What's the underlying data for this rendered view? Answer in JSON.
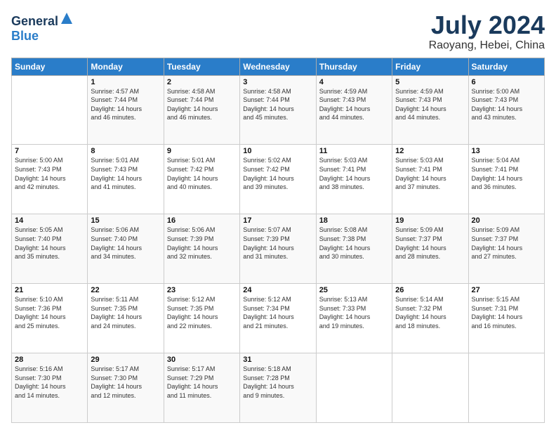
{
  "logo": {
    "general": "General",
    "blue": "Blue"
  },
  "header": {
    "month": "July 2024",
    "location": "Raoyang, Hebei, China"
  },
  "days_of_week": [
    "Sunday",
    "Monday",
    "Tuesday",
    "Wednesday",
    "Thursday",
    "Friday",
    "Saturday"
  ],
  "weeks": [
    [
      {
        "day": "",
        "content": ""
      },
      {
        "day": "1",
        "content": "Sunrise: 4:57 AM\nSunset: 7:44 PM\nDaylight: 14 hours\nand 46 minutes."
      },
      {
        "day": "2",
        "content": "Sunrise: 4:58 AM\nSunset: 7:44 PM\nDaylight: 14 hours\nand 46 minutes."
      },
      {
        "day": "3",
        "content": "Sunrise: 4:58 AM\nSunset: 7:44 PM\nDaylight: 14 hours\nand 45 minutes."
      },
      {
        "day": "4",
        "content": "Sunrise: 4:59 AM\nSunset: 7:43 PM\nDaylight: 14 hours\nand 44 minutes."
      },
      {
        "day": "5",
        "content": "Sunrise: 4:59 AM\nSunset: 7:43 PM\nDaylight: 14 hours\nand 44 minutes."
      },
      {
        "day": "6",
        "content": "Sunrise: 5:00 AM\nSunset: 7:43 PM\nDaylight: 14 hours\nand 43 minutes."
      }
    ],
    [
      {
        "day": "7",
        "content": "Sunrise: 5:00 AM\nSunset: 7:43 PM\nDaylight: 14 hours\nand 42 minutes."
      },
      {
        "day": "8",
        "content": "Sunrise: 5:01 AM\nSunset: 7:43 PM\nDaylight: 14 hours\nand 41 minutes."
      },
      {
        "day": "9",
        "content": "Sunrise: 5:01 AM\nSunset: 7:42 PM\nDaylight: 14 hours\nand 40 minutes."
      },
      {
        "day": "10",
        "content": "Sunrise: 5:02 AM\nSunset: 7:42 PM\nDaylight: 14 hours\nand 39 minutes."
      },
      {
        "day": "11",
        "content": "Sunrise: 5:03 AM\nSunset: 7:41 PM\nDaylight: 14 hours\nand 38 minutes."
      },
      {
        "day": "12",
        "content": "Sunrise: 5:03 AM\nSunset: 7:41 PM\nDaylight: 14 hours\nand 37 minutes."
      },
      {
        "day": "13",
        "content": "Sunrise: 5:04 AM\nSunset: 7:41 PM\nDaylight: 14 hours\nand 36 minutes."
      }
    ],
    [
      {
        "day": "14",
        "content": "Sunrise: 5:05 AM\nSunset: 7:40 PM\nDaylight: 14 hours\nand 35 minutes."
      },
      {
        "day": "15",
        "content": "Sunrise: 5:06 AM\nSunset: 7:40 PM\nDaylight: 14 hours\nand 34 minutes."
      },
      {
        "day": "16",
        "content": "Sunrise: 5:06 AM\nSunset: 7:39 PM\nDaylight: 14 hours\nand 32 minutes."
      },
      {
        "day": "17",
        "content": "Sunrise: 5:07 AM\nSunset: 7:39 PM\nDaylight: 14 hours\nand 31 minutes."
      },
      {
        "day": "18",
        "content": "Sunrise: 5:08 AM\nSunset: 7:38 PM\nDaylight: 14 hours\nand 30 minutes."
      },
      {
        "day": "19",
        "content": "Sunrise: 5:09 AM\nSunset: 7:37 PM\nDaylight: 14 hours\nand 28 minutes."
      },
      {
        "day": "20",
        "content": "Sunrise: 5:09 AM\nSunset: 7:37 PM\nDaylight: 14 hours\nand 27 minutes."
      }
    ],
    [
      {
        "day": "21",
        "content": "Sunrise: 5:10 AM\nSunset: 7:36 PM\nDaylight: 14 hours\nand 25 minutes."
      },
      {
        "day": "22",
        "content": "Sunrise: 5:11 AM\nSunset: 7:35 PM\nDaylight: 14 hours\nand 24 minutes."
      },
      {
        "day": "23",
        "content": "Sunrise: 5:12 AM\nSunset: 7:35 PM\nDaylight: 14 hours\nand 22 minutes."
      },
      {
        "day": "24",
        "content": "Sunrise: 5:12 AM\nSunset: 7:34 PM\nDaylight: 14 hours\nand 21 minutes."
      },
      {
        "day": "25",
        "content": "Sunrise: 5:13 AM\nSunset: 7:33 PM\nDaylight: 14 hours\nand 19 minutes."
      },
      {
        "day": "26",
        "content": "Sunrise: 5:14 AM\nSunset: 7:32 PM\nDaylight: 14 hours\nand 18 minutes."
      },
      {
        "day": "27",
        "content": "Sunrise: 5:15 AM\nSunset: 7:31 PM\nDaylight: 14 hours\nand 16 minutes."
      }
    ],
    [
      {
        "day": "28",
        "content": "Sunrise: 5:16 AM\nSunset: 7:30 PM\nDaylight: 14 hours\nand 14 minutes."
      },
      {
        "day": "29",
        "content": "Sunrise: 5:17 AM\nSunset: 7:30 PM\nDaylight: 14 hours\nand 12 minutes."
      },
      {
        "day": "30",
        "content": "Sunrise: 5:17 AM\nSunset: 7:29 PM\nDaylight: 14 hours\nand 11 minutes."
      },
      {
        "day": "31",
        "content": "Sunrise: 5:18 AM\nSunset: 7:28 PM\nDaylight: 14 hours\nand 9 minutes."
      },
      {
        "day": "",
        "content": ""
      },
      {
        "day": "",
        "content": ""
      },
      {
        "day": "",
        "content": ""
      }
    ]
  ]
}
